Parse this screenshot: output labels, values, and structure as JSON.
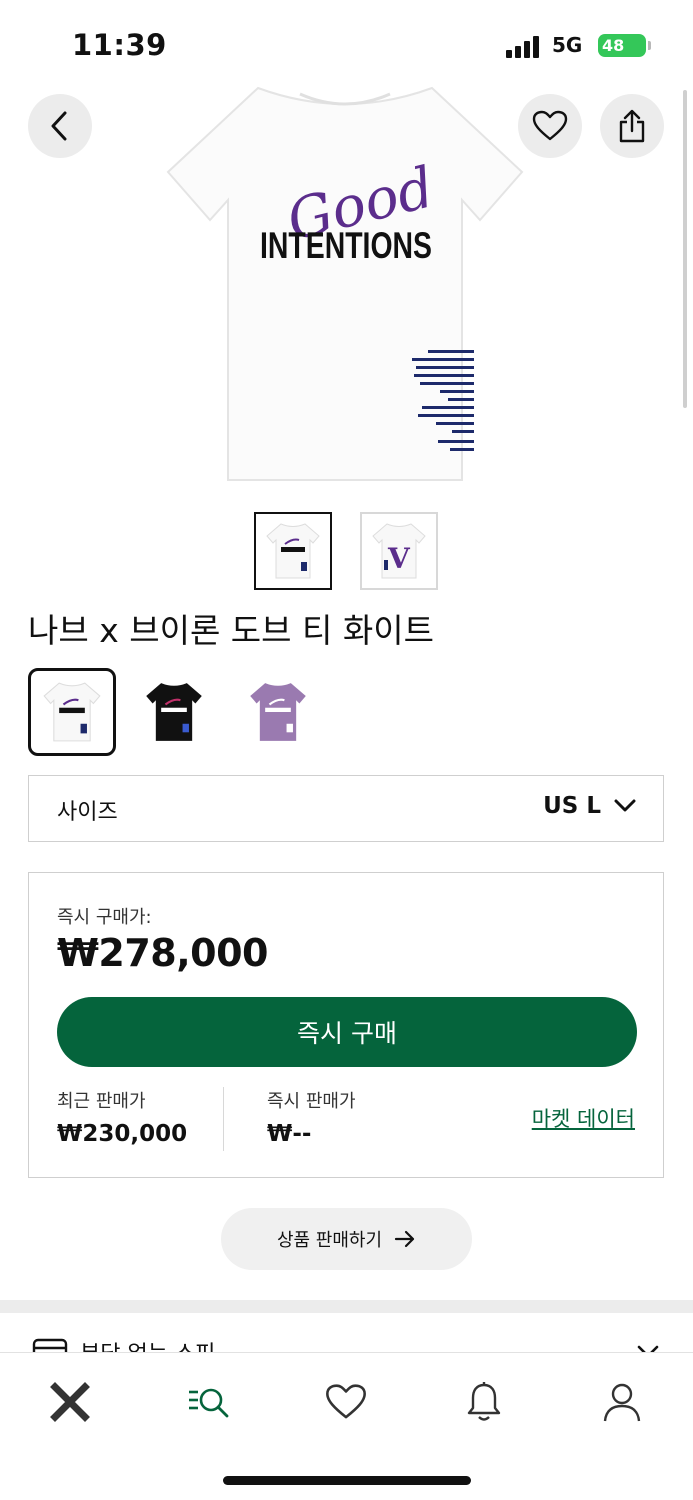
{
  "status_bar": {
    "time": "11:39",
    "network": "5G",
    "battery": "48"
  },
  "product": {
    "name": "나브 x 브이론 도브 티 화이트",
    "hero_print_top": "Good",
    "hero_print_main": "INTENTIONS",
    "thumb_2_letter": "V"
  },
  "size": {
    "label": "사이즈",
    "value": "US L"
  },
  "buy_now": {
    "label": "즉시 구매가:",
    "price": "₩278,000",
    "button": "즉시 구매"
  },
  "stats": {
    "recent_label": "최근 판매가",
    "recent_value": "₩230,000",
    "instant_sell_label": "즉시 판매가",
    "instant_sell_value": "₩--",
    "market_link": "마켓 데이터"
  },
  "sell_button": "상품 판매하기",
  "next_section_peek": "부담 없는 스피",
  "colors": {
    "accent_green": "#05643c",
    "print_purple": "#5b2d8c",
    "shirt_purple": "#9a7ab0"
  }
}
